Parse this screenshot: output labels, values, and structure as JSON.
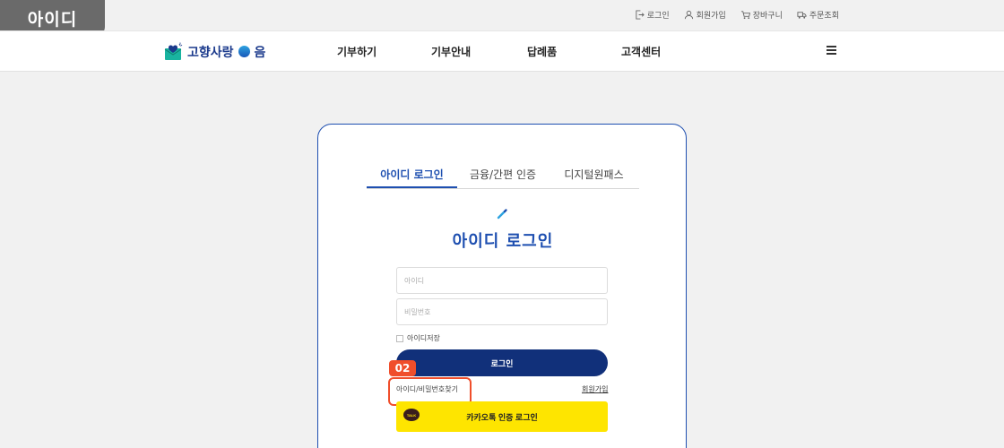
{
  "section_badge": "아이디",
  "util_nav": [
    {
      "label": "로그인",
      "icon": "login-icon"
    },
    {
      "label": "회원가입",
      "icon": "user-icon"
    },
    {
      "label": "장바구니",
      "icon": "cart-icon"
    },
    {
      "label": "주문조회",
      "icon": "truck-icon"
    }
  ],
  "header": {
    "logo_pre": "고향사랑",
    "logo_post": "음",
    "gnb": [
      "기부하기",
      "기부안내",
      "답례품",
      "고객센터"
    ]
  },
  "login": {
    "tabs": [
      "아이디 로그인",
      "금융/간편 인증",
      "디지털원패스"
    ],
    "title": "아이디 로그인",
    "id_placeholder": "아이디",
    "pw_placeholder": "비밀번호",
    "save_id": "아이디저장",
    "login_button": "로그인",
    "find_link": "아이디/비밀번호찾기",
    "join_link": "회원가입",
    "kakao_button": "카카오톡 인증 로그인",
    "kakao_icon_label": "TALK"
  },
  "annotation": {
    "step": "02"
  },
  "colors": {
    "primary": "#1e4fb0",
    "login_button": "#11307a",
    "highlight": "#f04e2b",
    "kakao": "#fee500"
  }
}
